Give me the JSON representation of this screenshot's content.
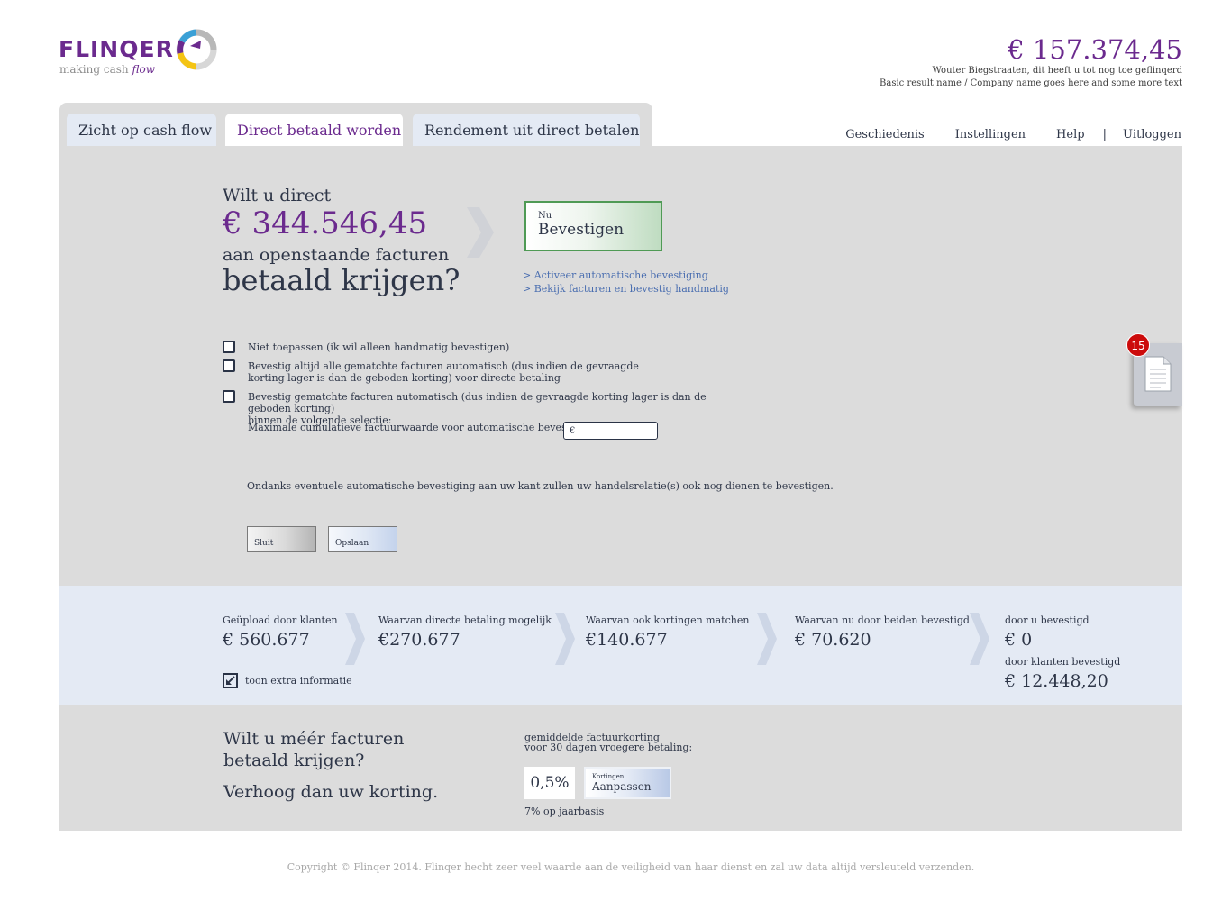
{
  "brand": {
    "name": "FLINQER",
    "tagline_prefix": "making cash",
    "tagline_emphasis": "flow",
    "colors": {
      "purple": "#6b2a8e",
      "green": "#4f9a55",
      "link": "#4a6eb0",
      "badge": "#cc0b0b"
    }
  },
  "header": {
    "total_amount": "€ 157.374,45",
    "line1": "Wouter Biegstraaten, dit heeft u tot nog toe geflinqerd",
    "line2": "Basic result name / Company name goes here and some more text"
  },
  "tabs": [
    {
      "label": "Zicht op cash flow",
      "active": false
    },
    {
      "label": "Direct betaald worden",
      "active": true
    },
    {
      "label": "Rendement uit direct betalen",
      "active": false
    }
  ],
  "topnav": {
    "history": "Geschiedenis",
    "settings": "Instellingen",
    "help": "Help",
    "separator": "|",
    "logout": "Uitloggen"
  },
  "question": {
    "pre": "Wilt u direct",
    "amount": "€ 344.546,45",
    "mid": "aan openstaande facturen",
    "big": "betaald krijgen?"
  },
  "confirm": {
    "small": "Nu",
    "label": "Bevestigen"
  },
  "links": {
    "auto": "> Activeer automatische bevestiging",
    "manual": "> Bekijk facturen en bevestig handmatig"
  },
  "options": [
    {
      "text": "Niet toepassen (ik wil alleen handmatig bevestigen)",
      "checked": false
    },
    {
      "text": "Bevestig altijd alle gematchte facturen automatisch (dus indien de gevraagde\nkorting lager is dan de geboden korting) voor directe betaling",
      "checked": false
    },
    {
      "text": "Bevestig gematchte facturen automatisch (dus indien de gevraagde korting lager is dan de geboden korting)\nbinnen de volgende selectie:",
      "checked": false
    }
  ],
  "max_value": {
    "label": "Maximale cumulatieve factuurwaarde voor automatische bevestiging:",
    "value": "€"
  },
  "notice": "Ondanks eventuele automatische bevestiging aan uw kant zullen uw handelsrelatie(s) ook nog dienen te bevestigen.",
  "buttons": {
    "close": "Sluit",
    "save": "Opslaan"
  },
  "documents": {
    "badge_count": "15",
    "icon": "document-icon"
  },
  "stats": {
    "uploaded": {
      "label": "Geüpload door klanten",
      "value": "€ 560.677"
    },
    "direct": {
      "label": "Waarvan directe betaling mogelijk",
      "value": "€270.677"
    },
    "discount_match": {
      "label": "Waarvan ook kortingen matchen",
      "value": "€140.677"
    },
    "both_confirmed": {
      "label": "Waarvan nu door beiden bevestigd",
      "value": "€ 70.620"
    },
    "you_confirmed": {
      "label": "door u bevestigd",
      "value": "€ 0"
    },
    "clients_confirmed": {
      "label": "door klanten bevestigd",
      "value": "€ 12.448,20"
    },
    "extra_info": "toon extra informatie"
  },
  "discount": {
    "question_line1": "Wilt u méér facturen",
    "question_line2": "betaald krijgen?",
    "cta": "Verhoog dan uw korting.",
    "label_line1": "gemiddelde factuurkorting",
    "label_line2": "voor 30 dagen vroegere betaling:",
    "percentage": "0,5%",
    "button_small": "Kortingen",
    "button_label": "Aanpassen",
    "annual": "7% op jaarbasis"
  },
  "footer": "Copyright © Flinqer 2014. Flinqer hecht zeer veel waarde aan de veiligheid van haar dienst en zal uw data altijd versleuteld verzenden."
}
